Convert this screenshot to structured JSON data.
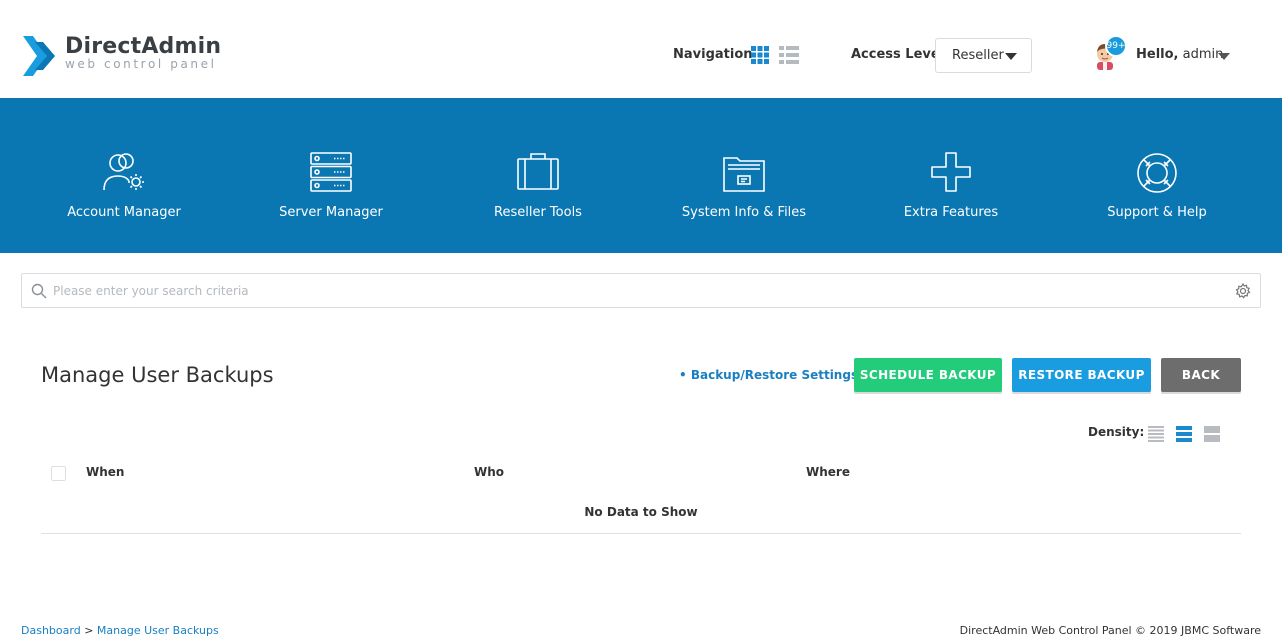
{
  "brand": {
    "name": "DirectAdmin",
    "tagline": "web control panel",
    "accent": "#0a77b3"
  },
  "header": {
    "navigation_label": "Navigation",
    "access_level_label": "Access Level",
    "access_level_value": "Reseller",
    "notification_count": "99+",
    "greeting": "Hello,",
    "username": "admin"
  },
  "menu": [
    {
      "label": "Account Manager",
      "icon": "account-manager-icon"
    },
    {
      "label": "Server Manager",
      "icon": "server-manager-icon"
    },
    {
      "label": "Reseller Tools",
      "icon": "briefcase-icon"
    },
    {
      "label": "System Info & Files",
      "icon": "folder-icon"
    },
    {
      "label": "Extra Features",
      "icon": "plus-icon"
    },
    {
      "label": "Support & Help",
      "icon": "lifebuoy-icon"
    }
  ],
  "search": {
    "placeholder": "Please enter your search criteria"
  },
  "page": {
    "title": "Manage User Backups",
    "settings_link": "• Backup/Restore Settings",
    "buttons": {
      "schedule": "SCHEDULE BACKUP",
      "restore": "RESTORE BACKUP",
      "back": "BACK"
    },
    "density_label": "Density:",
    "table": {
      "columns": [
        "When",
        "Who",
        "Where"
      ],
      "empty_message": "No Data to Show"
    }
  },
  "footer": {
    "breadcrumb": [
      "Dashboard",
      "Manage User Backups"
    ],
    "breadcrumb_separator": ">",
    "copyright": "DirectAdmin Web Control Panel © 2019 JBMC Software"
  },
  "colors": {
    "schedule_button": "#22cc7a",
    "restore_button": "#1a9de0",
    "back_button": "#6d6d6d",
    "link": "#1a7fc1"
  }
}
